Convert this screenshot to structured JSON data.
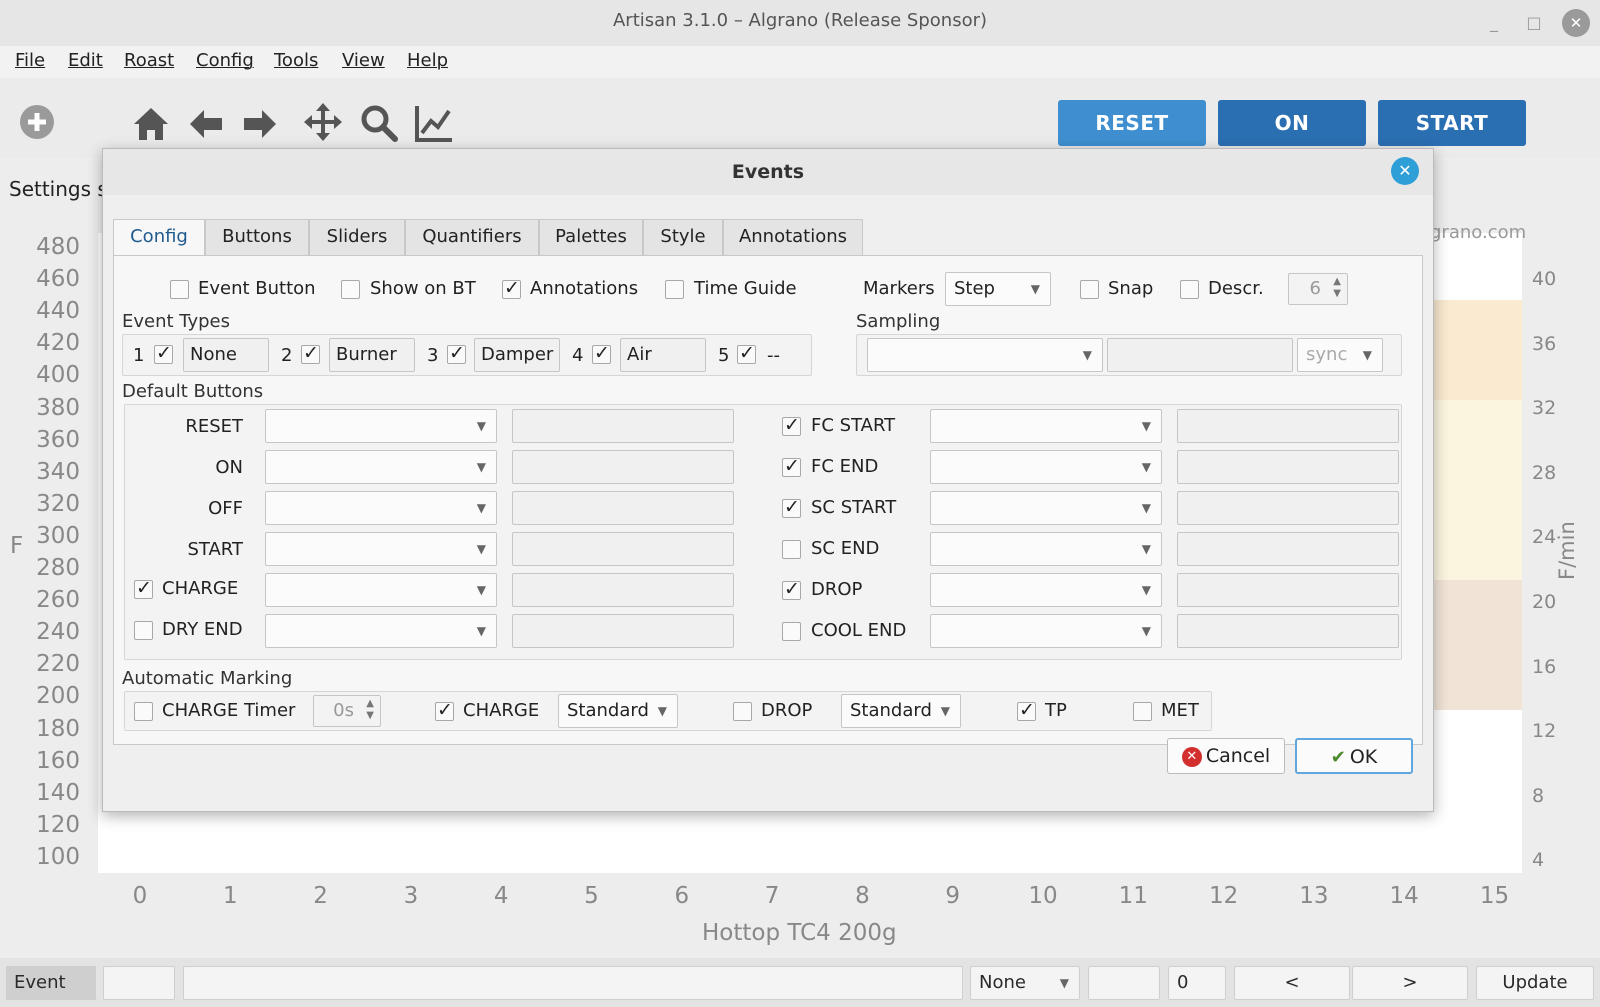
{
  "window": {
    "title": "Artisan 3.1.0 – Algrano (Release Sponsor)",
    "minimize": "_",
    "maximize": "□",
    "close": "✕"
  },
  "menu": [
    "File",
    "Edit",
    "Roast",
    "Config",
    "Tools",
    "View",
    "Help"
  ],
  "toolbar": {
    "reset": "RESET",
    "on": "ON",
    "start": "START",
    "colors": {
      "reset": "#3f8fd0",
      "on": "#2a6fb2",
      "start": "#2a6fb2"
    }
  },
  "background": {
    "settings_label": "Settings s",
    "brand": "grano.com",
    "y_left": [
      "480",
      "460",
      "440",
      "420",
      "400",
      "380",
      "360",
      "340",
      "320",
      "300",
      "280",
      "260",
      "240",
      "220",
      "200",
      "180",
      "160",
      "140",
      "120",
      "100"
    ],
    "y_left_unit": "F",
    "y_right": [
      "40",
      "36",
      "32",
      "28",
      "24",
      "20",
      "16",
      "12",
      "8",
      "4"
    ],
    "y_right_unit": "F/min",
    "x_ticks": [
      "0",
      "1",
      "2",
      "3",
      "4",
      "5",
      "6",
      "7",
      "8",
      "9",
      "10",
      "11",
      "12",
      "13",
      "14",
      "15"
    ],
    "x_title": "Hottop TC4 200g"
  },
  "statusbar": {
    "event": "Event #0",
    "combo": "None",
    "number": "0",
    "prev": "<",
    "next": ">",
    "update": "Update"
  },
  "dialog": {
    "title": "Events",
    "close": "✕",
    "tabs": [
      "Config",
      "Buttons",
      "Sliders",
      "Quantifiers",
      "Palettes",
      "Style",
      "Annotations"
    ],
    "options": {
      "event_button": {
        "label": "Event Button",
        "checked": false
      },
      "show_on_bt": {
        "label": "Show on BT",
        "checked": false
      },
      "annotations": {
        "label": "Annotations",
        "checked": true
      },
      "time_guide": {
        "label": "Time Guide",
        "checked": false
      },
      "markers_label": "Markers",
      "markers_value": "Step",
      "snap": {
        "label": "Snap",
        "checked": false
      },
      "descr": {
        "label": "Descr.",
        "checked": false
      },
      "descr_value": "6"
    },
    "event_types_label": "Event Types",
    "event_types": [
      {
        "num": "1",
        "checked": true,
        "name": "None"
      },
      {
        "num": "2",
        "checked": true,
        "name": "Burner"
      },
      {
        "num": "3",
        "checked": true,
        "name": "Damper"
      },
      {
        "num": "4",
        "checked": true,
        "name": "Air"
      },
      {
        "num": "5",
        "checked": true,
        "name": "--"
      }
    ],
    "sampling_label": "Sampling",
    "sampling_sync": "sync",
    "default_buttons_label": "Default Buttons",
    "left_buttons": [
      {
        "label": "RESET",
        "has_check": false
      },
      {
        "label": "ON",
        "has_check": false
      },
      {
        "label": "OFF",
        "has_check": false
      },
      {
        "label": "START",
        "has_check": false
      },
      {
        "label": "CHARGE",
        "has_check": true,
        "checked": true
      },
      {
        "label": "DRY END",
        "has_check": true,
        "checked": false
      }
    ],
    "right_buttons": [
      {
        "label": "FC START",
        "checked": true
      },
      {
        "label": "FC END",
        "checked": true
      },
      {
        "label": "SC START",
        "checked": true
      },
      {
        "label": "SC END",
        "checked": false
      },
      {
        "label": "DROP",
        "checked": true
      },
      {
        "label": "COOL END",
        "checked": false
      }
    ],
    "auto_marking_label": "Automatic Marking",
    "auto": {
      "charge_timer": {
        "label": "CHARGE Timer",
        "checked": false,
        "value": "0s"
      },
      "charge": {
        "label": "CHARGE",
        "checked": true,
        "mode": "Standard"
      },
      "drop": {
        "label": "DROP",
        "checked": false,
        "mode": "Standard"
      },
      "tp": {
        "label": "TP",
        "checked": true
      },
      "met": {
        "label": "MET",
        "checked": false
      }
    },
    "cancel": "Cancel",
    "ok": "OK"
  }
}
